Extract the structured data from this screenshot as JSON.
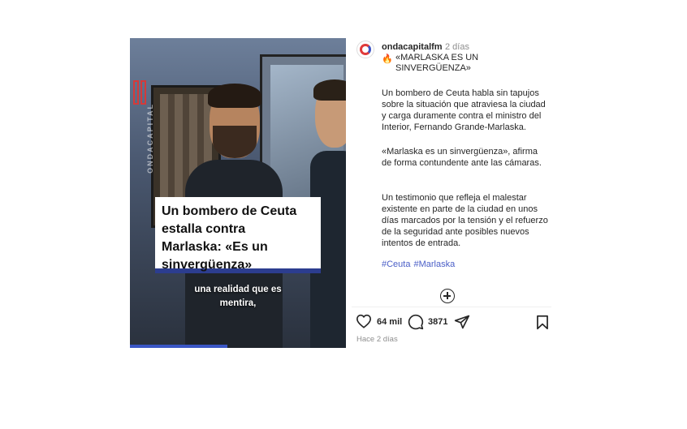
{
  "video": {
    "watermark": "ONDACAPITAL",
    "headline": "Un bombero de Ceuta\nestalla contra\nMarlaska: «Es un\nsinvergüenza»",
    "subtitle": "una realidad que es\nmentira,"
  },
  "post": {
    "username": "ondacapitalfm",
    "posted_ago": "2 días",
    "title_emoji": "🔥",
    "title": "«MARLASKA ES UN SINVERGÜENZA»",
    "paragraphs": [
      "Un bombero de Ceuta habla sin tapujos sobre la situación que atraviesa la ciudad y carga duramente contra el ministro del Interior, Fernando Grande-Marlaska.",
      "«Marlaska es un sinvergüenza», afirma de forma contundente ante las cámaras.",
      "Un testimonio que refleja el malestar existente en parte de la ciudad en unos días marcados por la tensión y el refuerzo de la seguridad ante posibles nuevos intentos de entrada."
    ],
    "hashtags": [
      "#Ceuta",
      "#Marlaska"
    ]
  },
  "actions": {
    "likes": "64 mil",
    "comments": "3871",
    "icons": [
      "heart-icon",
      "comment-icon",
      "share-icon",
      "bookmark-icon",
      "add-circle-icon"
    ]
  },
  "footer": {
    "time_ago": "Hace 2 días"
  },
  "colors": {
    "accent_blue": "#3d54c4",
    "mic_red": "#e0272a",
    "hashtag": "#4a5ec7",
    "muted": "#8e8e8e"
  }
}
